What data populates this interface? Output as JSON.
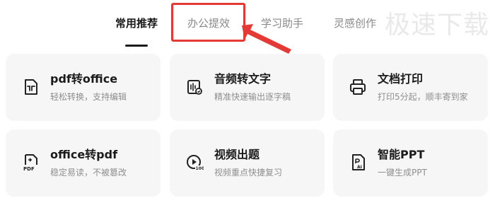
{
  "tabs": [
    {
      "label": "常用推荐",
      "active": true
    },
    {
      "label": "办公提效",
      "active": false
    },
    {
      "label": "学习助手",
      "active": false
    },
    {
      "label": "灵感创作",
      "active": false
    }
  ],
  "watermark": "极速下载",
  "colors": {
    "highlight": "#e53935",
    "card_bg": "#f6f6f7",
    "title": "#1b1b1b",
    "desc": "#8e8e8e",
    "tab_inactive": "#8a8a8a"
  },
  "cards": [
    {
      "title": "pdf转office",
      "desc": "轻松转换，支持编辑",
      "icon": "pdf-convert-icon"
    },
    {
      "title": "音频转文字",
      "desc": "精准快速输出逐字稿",
      "icon": "audio-to-text-icon"
    },
    {
      "title": "文档打印",
      "desc": "打印5分起，顺丰寄到家",
      "icon": "printer-icon"
    },
    {
      "title": "office转pdf",
      "desc": "稳定易读，不被篡改",
      "icon": "pdf-file-icon"
    },
    {
      "title": "视频出题",
      "desc": "视频重点快捷复习",
      "icon": "video-quiz-icon"
    },
    {
      "title": "智能PPT",
      "desc": "一键生成PPT",
      "icon": "ppt-ai-icon"
    }
  ]
}
